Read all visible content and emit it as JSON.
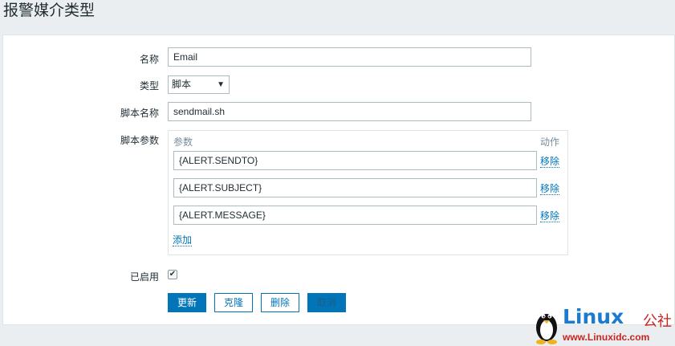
{
  "page": {
    "title": "报警媒介类型"
  },
  "form": {
    "name_label": "名称",
    "name_value": "Email",
    "type_label": "类型",
    "type_value": "脚本",
    "script_name_label": "脚本名称",
    "script_name_value": "sendmail.sh",
    "script_params_label": "脚本参数",
    "params_header": "参数",
    "action_header": "动作",
    "params": [
      {
        "value": "{ALERT.SENDTO}",
        "action": "移除"
      },
      {
        "value": "{ALERT.SUBJECT}",
        "action": "移除"
      },
      {
        "value": "{ALERT.MESSAGE}",
        "action": "移除"
      }
    ],
    "add_label": "添加",
    "enabled_label": "已启用",
    "enabled": true
  },
  "buttons": {
    "update": "更新",
    "clone": "克隆",
    "delete": "删除",
    "cancel": "取消"
  },
  "watermark": {
    "brand": "Linux",
    "brand_suffix": "公社",
    "url": "www.Linuxidc.com"
  },
  "colors": {
    "accent": "#0275b8",
    "background": "#ebeef0",
    "border": "#acbbc2"
  }
}
